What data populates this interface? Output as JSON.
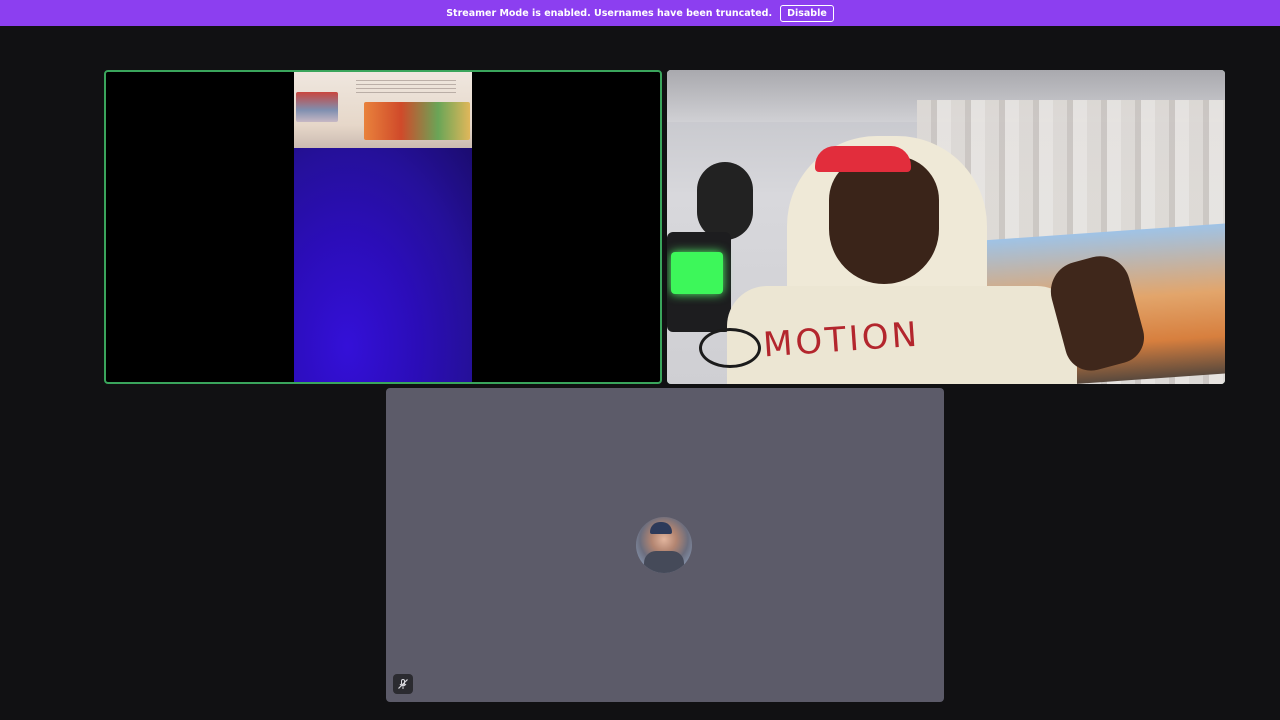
{
  "banner": {
    "message": "Streamer Mode is enabled. Usernames have been truncated.",
    "disable_label": "Disable"
  },
  "tiles": [
    {
      "type": "video",
      "speaking": true
    },
    {
      "type": "video",
      "speaking": true,
      "shirt_text": "MOTION"
    },
    {
      "type": "avatar",
      "speaking": false,
      "muted": true,
      "mute_icon": "mic-muted-icon"
    }
  ],
  "colors": {
    "banner": "#8c3ff0",
    "stage_bg": "#111113",
    "speaking_outline": "#3aa55c",
    "avatar_tile_bg": "#5c5b69"
  }
}
